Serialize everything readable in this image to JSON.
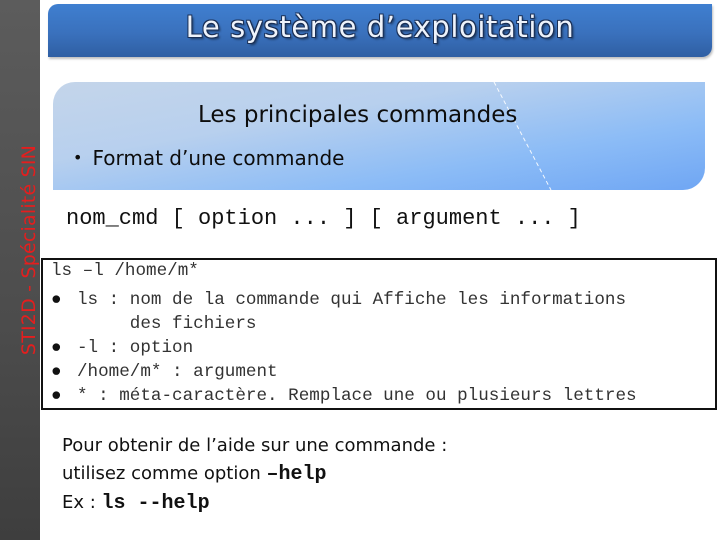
{
  "sidebar": {
    "label": "STI2D  -  Spécialité SIN",
    "text_color": "#e41e1e"
  },
  "title": {
    "text": "Le système d’exploitation",
    "banner_color": "#3a71bd"
  },
  "content": {
    "heading": "Les principales commandes",
    "bullet": "Format d’une commande"
  },
  "syntax": "nom_cmd [ option ... ] [ argument ... ]",
  "example": {
    "command": "ls –l /home/m*",
    "bullets": [
      {
        "text": "ls : nom de la commande qui Affiche les informations",
        "continuation": "     des fichiers"
      },
      {
        "text": "-l : option"
      },
      {
        "text": "/home/m* : argument"
      },
      {
        "text": "* : méta-caractère. Remplace une ou plusieurs lettres"
      }
    ]
  },
  "help": {
    "line1": "Pour obtenir de l’aide sur une commande :",
    "line2_prefix": "utilisez comme option ",
    "line2_code": "–help",
    "line3_prefix": "Ex : ",
    "line3_code": "ls --help"
  }
}
